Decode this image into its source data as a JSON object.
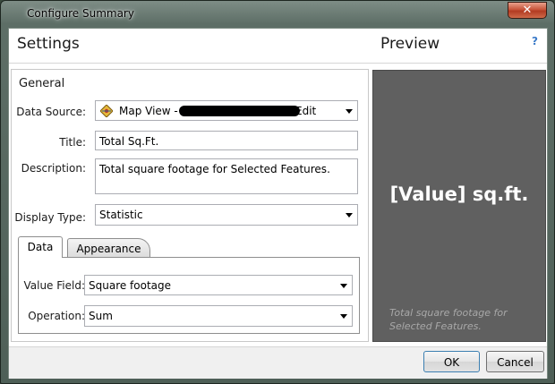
{
  "window": {
    "title": "Configure Summary",
    "close_glyph": "✕"
  },
  "header": {
    "settings_title": "Settings",
    "preview_title": "Preview",
    "help": "?"
  },
  "general": {
    "heading": "General",
    "data_source": {
      "label": "Data Source:",
      "value_prefix": "Map View - ",
      "value_suffix": "Edit",
      "icon": "map-view-icon"
    },
    "title": {
      "label": "Title:",
      "value": "Total Sq.Ft."
    },
    "description": {
      "label": "Description:",
      "value": "Total square footage for Selected Features."
    },
    "display_type": {
      "label": "Display Type:",
      "value": "Statistic"
    }
  },
  "tabs": [
    {
      "label": "Data",
      "selected": true
    },
    {
      "label": "Appearance",
      "selected": false
    }
  ],
  "data_tab": {
    "value_field": {
      "label": "Value Field:",
      "value": "Square footage"
    },
    "operation": {
      "label": "Operation:",
      "value": "Sum"
    }
  },
  "preview": {
    "value": "[Value] sq.ft.",
    "description": "Total square footage for Selected Features.",
    "background": "#606060"
  },
  "footer": {
    "ok_label": "OK",
    "cancel_label": "Cancel"
  }
}
